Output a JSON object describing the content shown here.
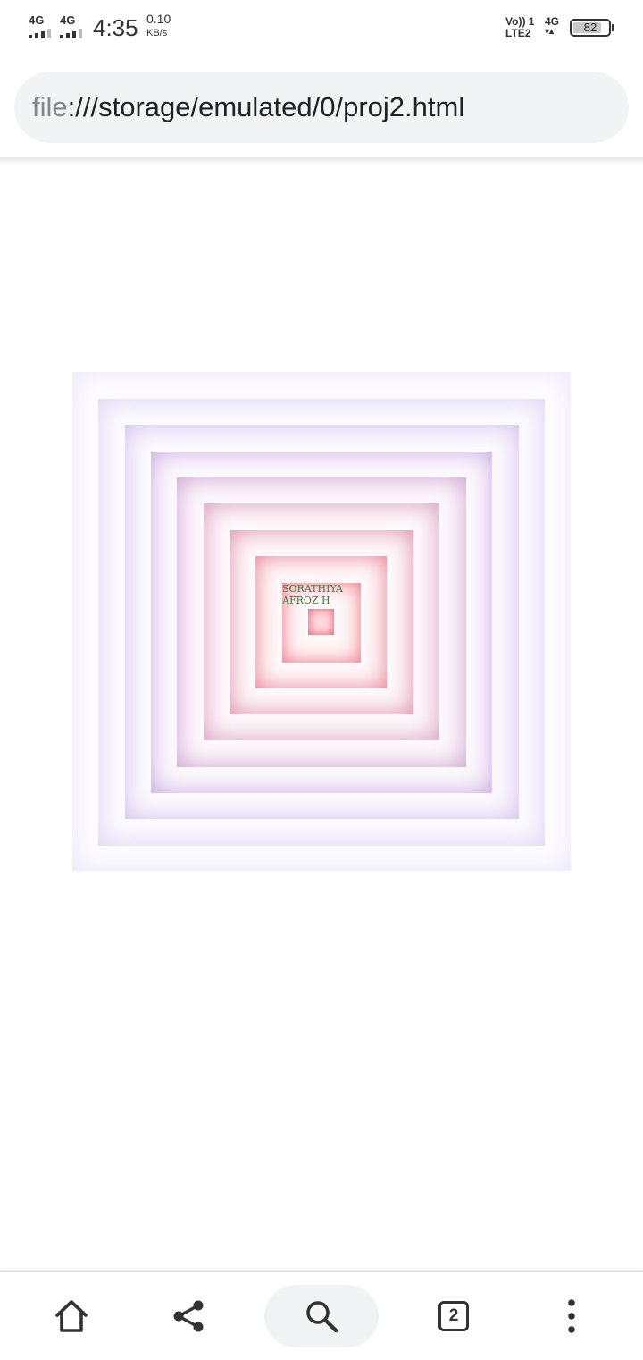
{
  "status_bar": {
    "sim1_network": "4G",
    "sim2_network": "4G",
    "time": "4:35",
    "speed_value": "0.10",
    "speed_unit": "KB/s",
    "volte_top": "Vo)) 1",
    "volte_bottom": "LTE2",
    "data_network": "4G",
    "data_arrows": "▾▴",
    "battery_level": "82",
    "battery_fraction": 0.82
  },
  "browser": {
    "url_scheme": "file",
    "url_rest": ":///storage/emulated/0/proj2.html"
  },
  "page": {
    "text_line1": "SORATHIYA",
    "text_line2": "AFROZ H",
    "text_color": "#3d7a3d"
  },
  "bottom_nav": {
    "tab_count": "2"
  },
  "icons": {
    "home": "home-icon",
    "share": "share-icon",
    "search": "search-icon",
    "tabs": "tab-switcher-icon",
    "menu": "more-vert-icon"
  },
  "colors": {
    "url_bar_bg": "#f1f3f4",
    "icon_color": "#333333",
    "accent_lavender": "#9a6fc4",
    "accent_pink": "#e05a7a"
  }
}
